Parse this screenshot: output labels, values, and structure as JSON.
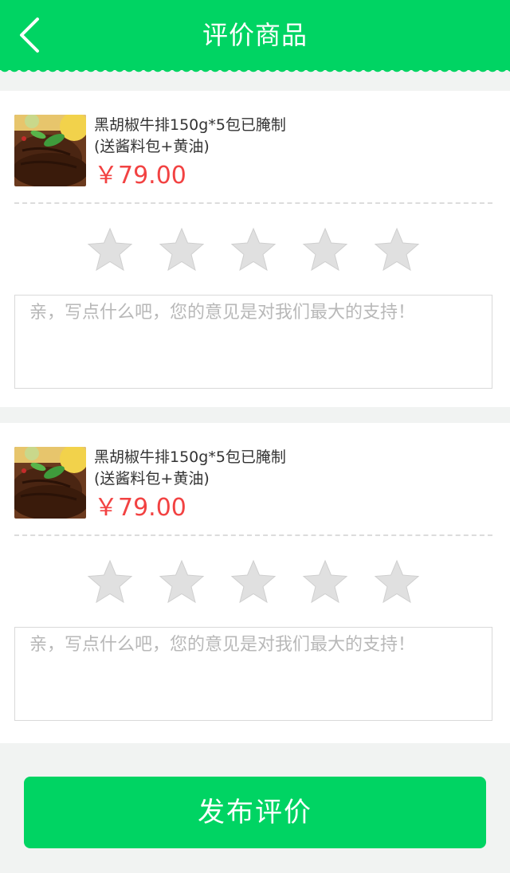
{
  "header": {
    "title": "评价商品"
  },
  "items": [
    {
      "name": "黑胡椒牛排150g*5包已腌制",
      "name_line2": "(送酱料包+黄油)",
      "price": "￥79.00",
      "rating": 0,
      "comment_placeholder": "亲，写点什么吧，您的意见是对我们最大的支持！"
    },
    {
      "name": "黑胡椒牛排150g*5包已腌制",
      "name_line2": "(送酱料包+黄油)",
      "price": "￥79.00",
      "rating": 0,
      "comment_placeholder": "亲，写点什么吧，您的意见是对我们最大的支持！"
    }
  ],
  "submit": {
    "label": "发布评价"
  },
  "colors": {
    "accent": "#00d463",
    "price": "#f24242",
    "star_empty": "#e0e0e0"
  },
  "icons": {
    "back": "chevron-left-icon",
    "star": "star-icon",
    "thumb": "steak-image"
  }
}
